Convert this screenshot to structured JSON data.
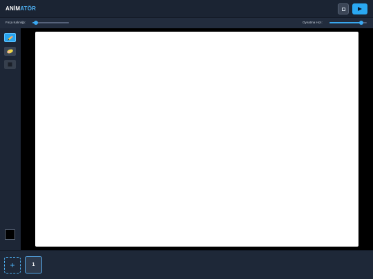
{
  "app": {
    "logo_part1": "ANİM",
    "logo_part2": "ATÖR"
  },
  "header": {
    "stop_icon": "stop-icon",
    "play_icon": "play-icon"
  },
  "toolbar": {
    "brush_label": "Fırça Kalınlığı:",
    "brush_value": 0.1,
    "speed_label": "Oynatma Hızı:",
    "speed_value": 0.85
  },
  "tools": [
    {
      "name": "pencil",
      "icon": "pencil-icon",
      "active": true
    },
    {
      "name": "eraser",
      "icon": "eraser-icon",
      "active": false
    },
    {
      "name": "fill",
      "icon": "paint-bucket-icon",
      "active": false
    }
  ],
  "current_color": "#000000",
  "colors": {
    "accent": "#2aa8f2",
    "background": "#1a2232",
    "canvas": "#ffffff"
  },
  "timeline": {
    "add_label": "+",
    "frames": [
      "1"
    ]
  }
}
